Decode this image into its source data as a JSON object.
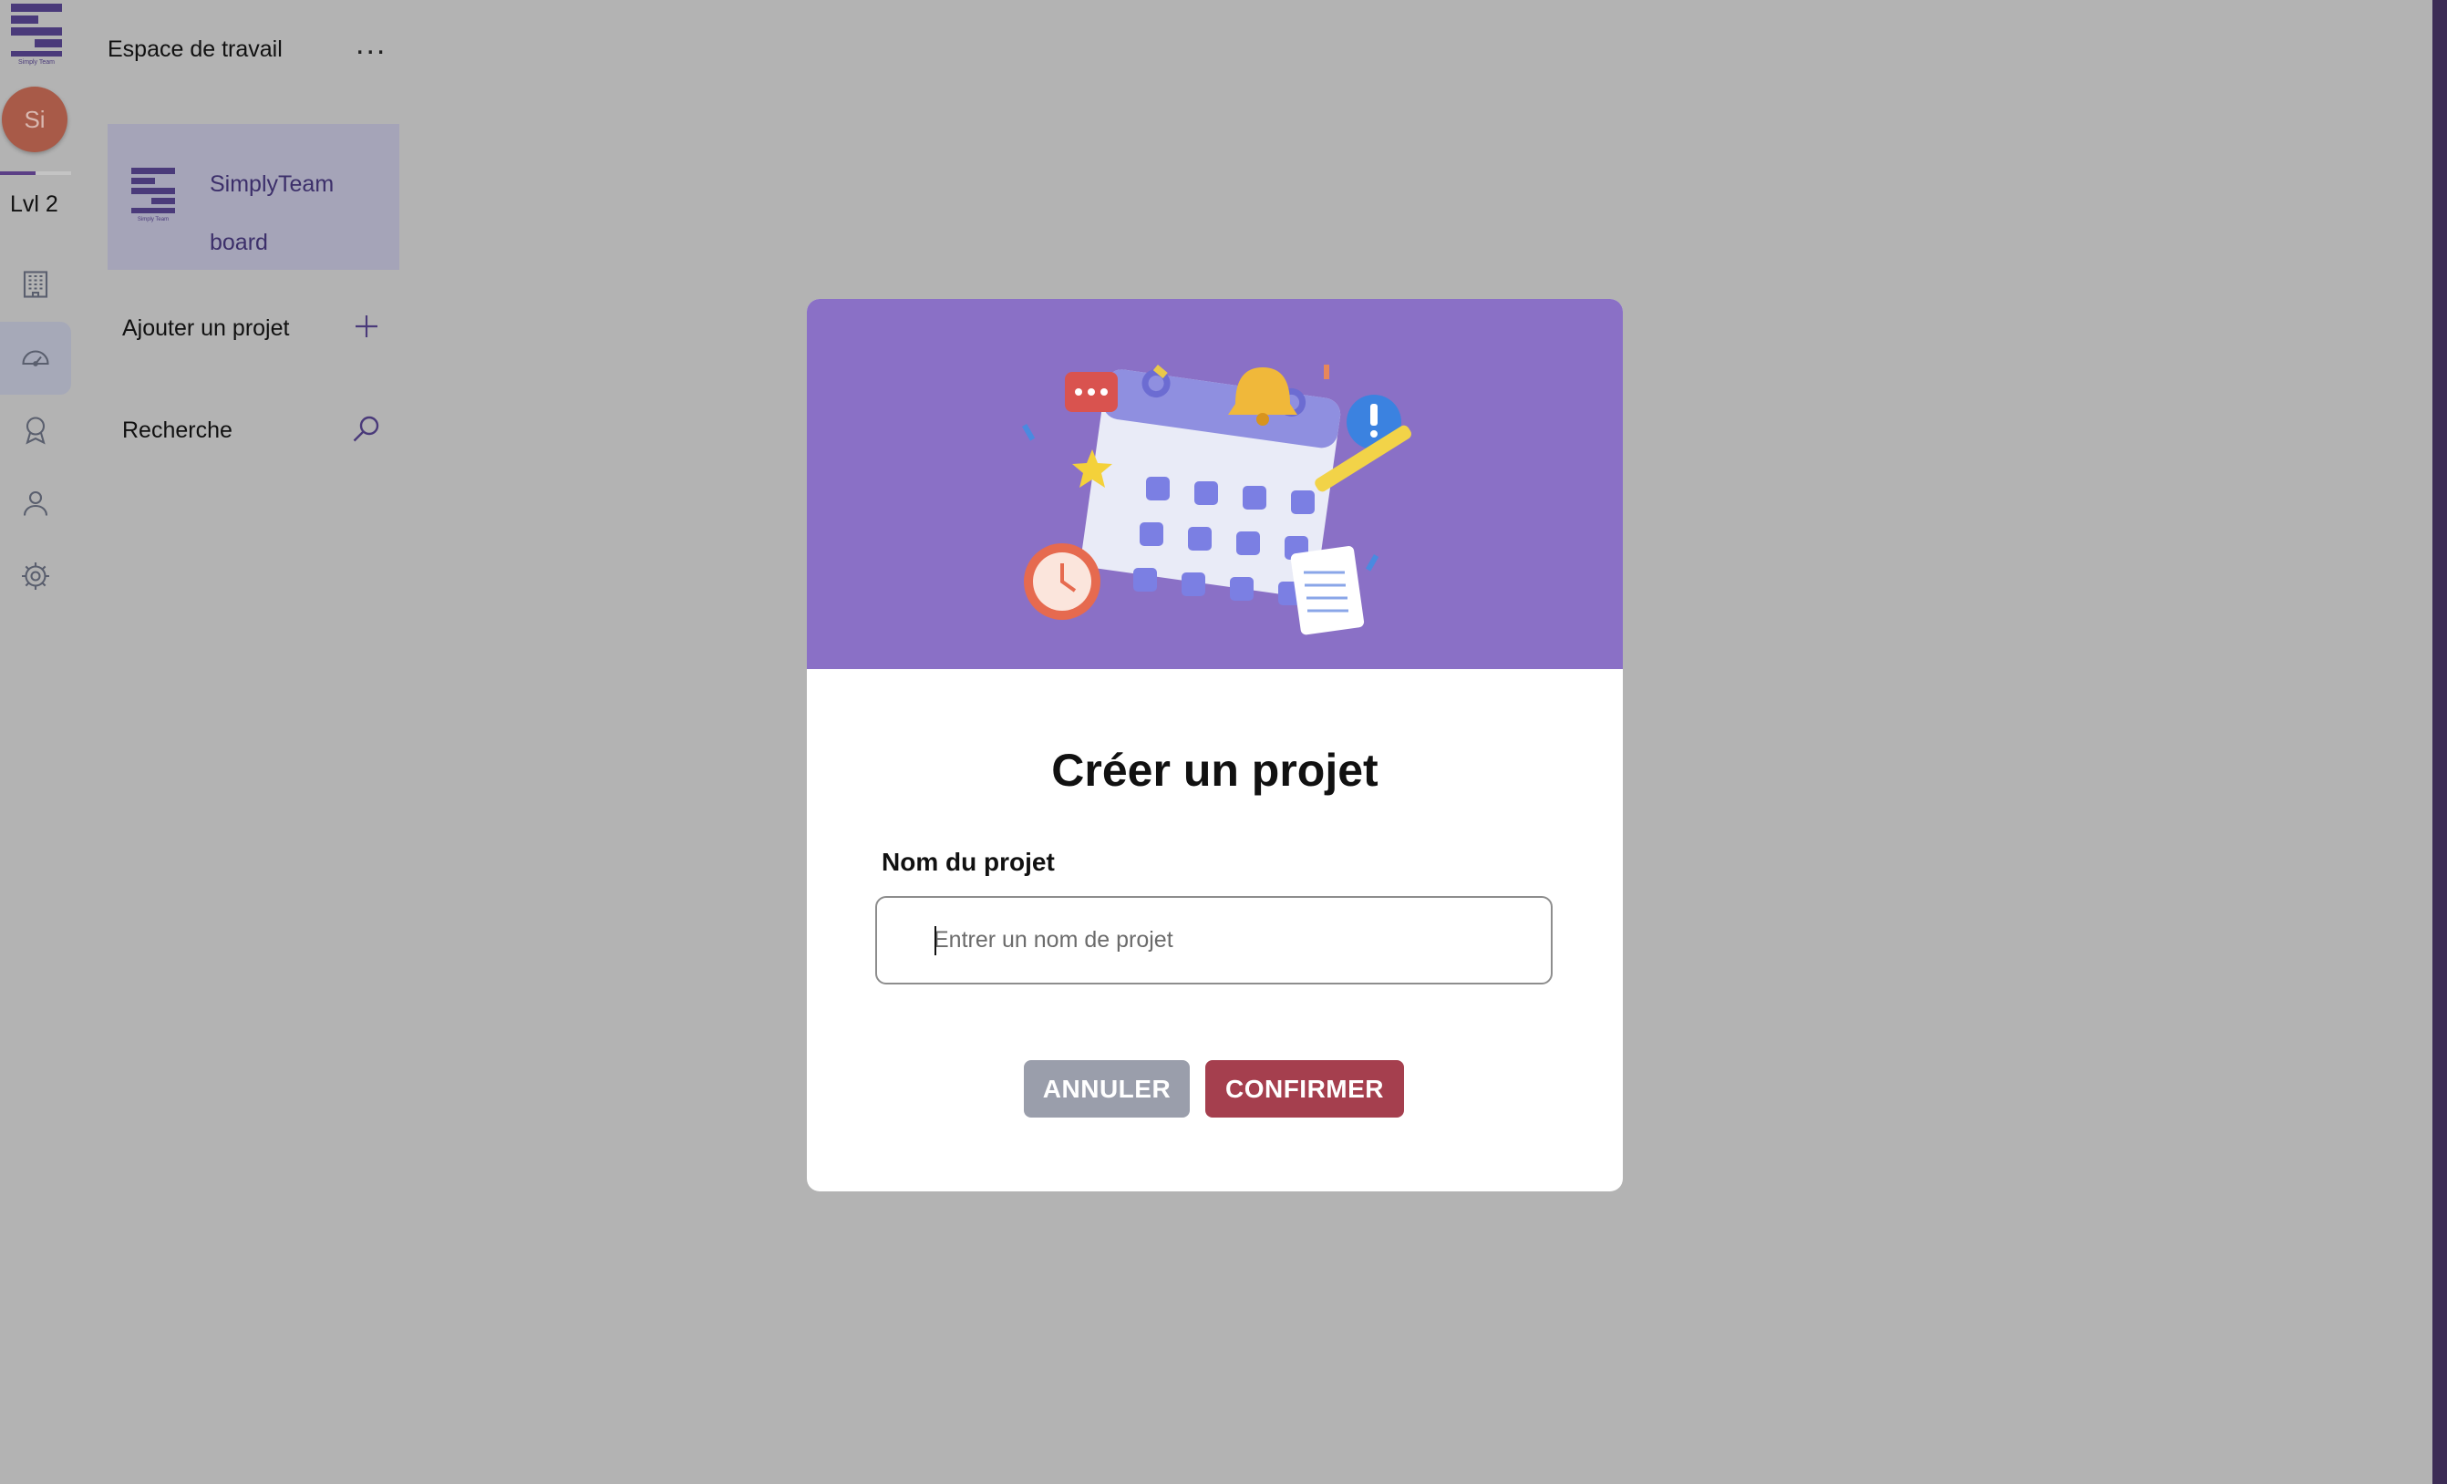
{
  "brand": {
    "logo_text": "Simply Team"
  },
  "user": {
    "avatar_initials": "Si",
    "level": "Lvl 2",
    "level_progress": 0.5
  },
  "rail": {
    "items": [
      {
        "icon": "building-icon",
        "active": false
      },
      {
        "icon": "dashboard-gauge-icon",
        "active": true
      },
      {
        "icon": "award-icon",
        "active": false
      },
      {
        "icon": "user-icon",
        "active": false
      },
      {
        "icon": "settings-gear-icon",
        "active": false
      }
    ]
  },
  "workspace": {
    "title": "Espace de travail",
    "more_label": "...",
    "board": {
      "name": "SimplyTeam board"
    },
    "add_project_label": "Ajouter un projet",
    "search_label": "Recherche"
  },
  "modal": {
    "title": "Créer un projet",
    "field_label": "Nom du projet",
    "field_placeholder": "Entrer un nom de projet",
    "field_value": "",
    "cancel_label": "ANNULER",
    "confirm_label": "CONFIRMER",
    "banner_color": "#8a70c6"
  },
  "colors": {
    "overlay": "#b3b3b3",
    "accent": "#5b3f86",
    "confirm": "#a53f4e",
    "cancel": "#9a9eab"
  }
}
